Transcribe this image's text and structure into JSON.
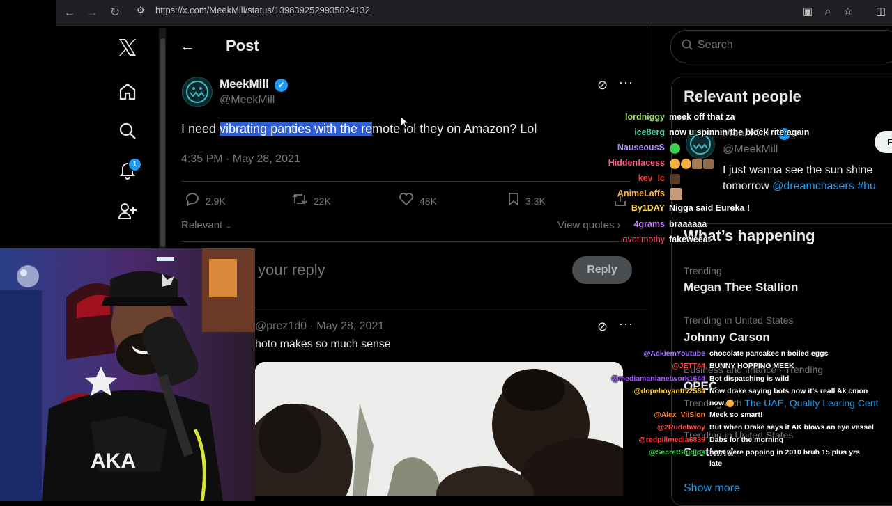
{
  "browser": {
    "url": "https://x.com/MeekMill/status/1398392529935024132"
  },
  "post": {
    "header_title": "Post",
    "display_name": "MeekMill",
    "handle": "@MeekMill",
    "text_before": "I need ",
    "text_highlight": "vibrating panties with the re",
    "text_after": "mote lol they on Amazon? Lol",
    "timestamp": "4:35 PM · May 28, 2021",
    "replies": "2.9K",
    "reposts": "22K",
    "likes": "48K",
    "bookmarks": "3.3K",
    "sort_label": "Relevant",
    "view_quotes": "View quotes",
    "reply_placeholder": "your reply",
    "reply_button": "Reply",
    "notification_count": "1"
  },
  "reply": {
    "handle_date": "@prez1d0 · May 28, 2021",
    "text": "hoto makes so much sense"
  },
  "sidebar": {
    "search_placeholder": "Search",
    "relevant_people_title": "Relevant people",
    "rp_name": "MeekMill",
    "rp_handle": "@MeekMill",
    "rp_bio_1": "I just wanna see the sun shine",
    "rp_bio_2_plain": "tomorrow ",
    "rp_bio_2_link": "@dreamchasers #hu",
    "follow_label": "F",
    "whats_happening_title": "What’s happening",
    "trends": [
      {
        "context": "Trending",
        "name": "Megan Thee Stallion"
      },
      {
        "context": "Trending in United States",
        "name": "Johnny Carson"
      },
      {
        "context": "Business and finance · Trending",
        "name": "OPEC"
      },
      {
        "context": "Trending in United States",
        "name": "Scotland"
      }
    ],
    "trend3_sub_plain": "Trending with ",
    "trend3_sub_link": "The UAE, Quality Learing Cent",
    "show_more": "Show more"
  },
  "chat_top": [
    {
      "user": "lordniggy",
      "color": "#9be564",
      "msg": "meek off that za"
    },
    {
      "user": "ice8erg",
      "color": "#3fd4a8",
      "msg": "now u spinnin the block rite again"
    },
    {
      "user": "NauseousS",
      "color": "#b08cff",
      "msg": ""
    },
    {
      "user": "Hiddenfacess",
      "color": "#ff5a7a",
      "msg": ""
    },
    {
      "user": "kev_lc",
      "color": "#ff3b3b",
      "msg": ""
    },
    {
      "user": "AnimeLaffs",
      "color": "#ffb347",
      "msg": ""
    },
    {
      "user": "By1DAY",
      "color": "#ffd34d",
      "msg": "Nigga said Eureka !"
    },
    {
      "user": "4grams",
      "color": "#c77dff",
      "msg": "braaaaaa"
    },
    {
      "user": "ovotimothy",
      "color": "#ff4d6d",
      "msg": "fakeweeat"
    }
  ],
  "chat_bottom": [
    {
      "user": "@AckiemYoutube",
      "color": "#a47dff",
      "msg": "chocolate pancakes n boiled eggs"
    },
    {
      "user": "@JETT44",
      "color": "#ff5050",
      "msg": "BUNNY HOPPING MEEK"
    },
    {
      "user": "@mediamanianetwork1644",
      "color": "#a35cff",
      "msg": "Bot dispatching is wild"
    },
    {
      "user": "@dopeboyanttv2584",
      "color": "#ffd23f",
      "msg": "Now drake saying bots now it's reall Ak cmon"
    },
    {
      "user": "",
      "color": "#ffffff",
      "msg": "now"
    },
    {
      "user": "@Alex_ViiSion",
      "color": "#ff7b2e",
      "msg": "Meek so smart!"
    },
    {
      "user": "@2Rudebwoy",
      "color": "#ff5a5a",
      "msg": "But when Drake says it AK blows an eye vessel"
    },
    {
      "user": "@redpillmedia6839",
      "color": "#ff3b3b",
      "msg": "Dabs for the morning"
    },
    {
      "user": "@SecretStudios",
      "color": "#32d74b",
      "msg": "bots were popping in 2010 bruh 15 plus yrs"
    },
    {
      "user": "",
      "color": "#ffffff",
      "msg": "late"
    }
  ],
  "colors": {
    "accent": "#1d9bf0",
    "highlight": "#2f5fd8",
    "border": "#2f3336",
    "muted": "#71767b"
  },
  "icons": [
    "back-icon",
    "forward-icon",
    "reload-icon",
    "site-settings-icon",
    "x-logo-icon",
    "home-icon",
    "search-icon",
    "bell-icon",
    "follow-icon",
    "grok-icon",
    "more-icon",
    "reply-icon",
    "repost-icon",
    "like-icon",
    "bookmark-icon",
    "share-icon"
  ]
}
